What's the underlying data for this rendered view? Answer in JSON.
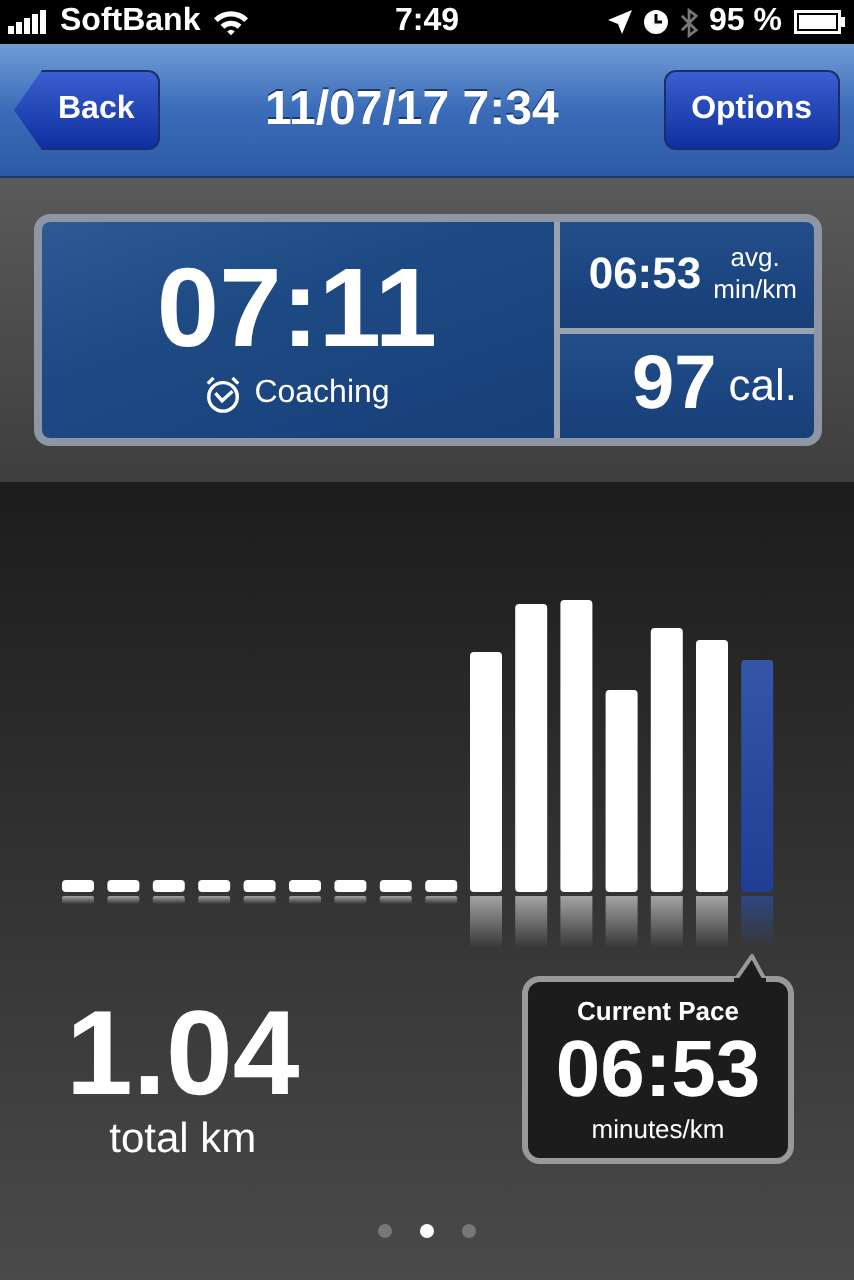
{
  "status_bar": {
    "carrier": "SoftBank",
    "time": "7:49",
    "battery": "95 %"
  },
  "nav_bar": {
    "back": "Back",
    "title": "11/07/17 7:34",
    "options": "Options"
  },
  "stats": {
    "duration": "07:11",
    "coaching": "Coaching",
    "pace": "06:53",
    "pace_unit_top": "avg.",
    "pace_unit_bottom": "min/km",
    "calories": "97",
    "calories_unit": "cal."
  },
  "distance": {
    "value": "1.04",
    "unit": "total km"
  },
  "current_pace": {
    "label": "Current Pace",
    "value": "06:53",
    "unit": "minutes/km"
  },
  "pages": [
    {
      "selected": false
    },
    {
      "selected": true
    },
    {
      "selected": false
    }
  ]
}
